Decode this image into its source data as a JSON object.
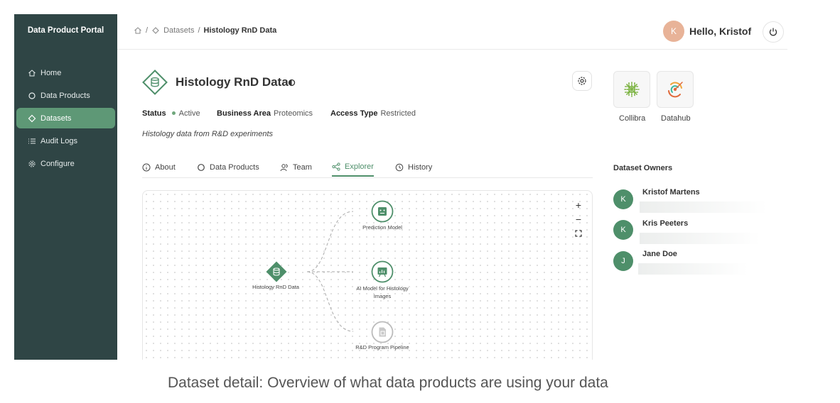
{
  "app": {
    "brand": "Data Product Portal"
  },
  "sidebar": {
    "items": [
      {
        "label": "Home",
        "icon": "home-icon"
      },
      {
        "label": "Data Products",
        "icon": "circle-icon"
      },
      {
        "label": "Datasets",
        "icon": "diamond-icon",
        "active": true
      },
      {
        "label": "Audit Logs",
        "icon": "list-icon"
      },
      {
        "label": "Configure",
        "icon": "gear-icon"
      }
    ]
  },
  "header": {
    "breadcrumb": [
      "Datasets",
      "Histology RnD Data"
    ],
    "separator": "/",
    "avatar_initial": "K",
    "greeting": "Hello, Kristof"
  },
  "dataset": {
    "title": "Histology RnD Data",
    "status_label": "Status",
    "status_value": "Active",
    "business_area_label": "Business Area",
    "business_area_value": "Proteomics",
    "access_type_label": "Access Type",
    "access_type_value": "Restricted",
    "description": "Histology data from R&D experiments"
  },
  "tabs": [
    {
      "label": "About",
      "icon": "info-icon"
    },
    {
      "label": "Data Products",
      "icon": "circle-icon"
    },
    {
      "label": "Team",
      "icon": "team-icon"
    },
    {
      "label": "Explorer",
      "icon": "share-nodes-icon",
      "active": true
    },
    {
      "label": "History",
      "icon": "history-icon"
    }
  ],
  "explorer": {
    "zoom_in": "+",
    "zoom_out": "−",
    "nodes": [
      {
        "label": "Histology RnD Data"
      },
      {
        "label": "Prediction Model"
      },
      {
        "label": "AI Model for Histology Images"
      },
      {
        "label": "R&D Program Pipeline"
      }
    ]
  },
  "integrations": [
    {
      "label": "Collibra",
      "icon": "collibra-icon"
    },
    {
      "label": "Datahub",
      "icon": "datahub-icon"
    }
  ],
  "owners": {
    "title": "Dataset Owners",
    "list": [
      {
        "initial": "K",
        "name": "Kristof Martens"
      },
      {
        "initial": "K",
        "name": "Kris Peeters"
      },
      {
        "initial": "J",
        "name": "Jane Doe"
      }
    ]
  },
  "caption": "Dataset detail: Overview of what data products are using your data",
  "colors": {
    "sidebar": "#2f4545",
    "accent": "#4e8f6a",
    "active_nav": "#5e9876",
    "user_avatar": "#e8b398"
  }
}
